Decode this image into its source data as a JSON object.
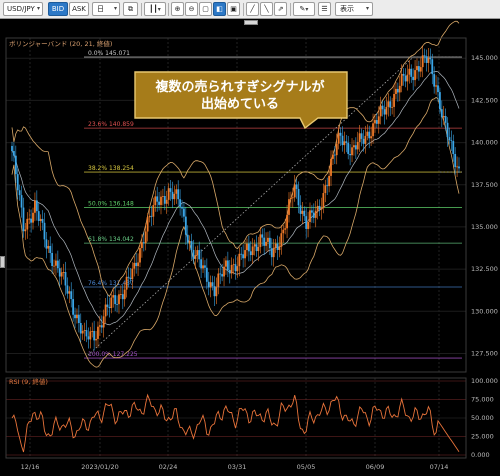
{
  "toolbar": {
    "pair": "USD/JPY",
    "bid": "BID",
    "ask": "ASK",
    "period": "日",
    "display": "表示"
  },
  "main_panel": {
    "indicator_label": "ボリンジャーバンド (20, 21, 終値)",
    "annotation": [
      "複数の売られすぎシグナルが",
      "出始めている"
    ],
    "fib_levels": [
      {
        "label": "0.0%  145.071",
        "value": 145.071,
        "color": "#c9c9c9"
      },
      {
        "label": "23.6%  140.859",
        "value": 140.859,
        "color": "#e05050"
      },
      {
        "label": "38.2%  138.254",
        "value": 138.254,
        "color": "#d8c840"
      },
      {
        "label": "50.0%  136.148",
        "value": 136.148,
        "color": "#5fd06a"
      },
      {
        "label": "61.8%  134.042",
        "value": 134.042,
        "color": "#6ad088"
      },
      {
        "label": "76.4%  131.437",
        "value": 131.437,
        "color": "#4a88d8"
      },
      {
        "label": "100.0%  127.225",
        "value": 127.225,
        "color": "#a855cc"
      }
    ],
    "y_ticks": [
      "145.000",
      "142.500",
      "140.000",
      "137.500",
      "135.000",
      "132.500",
      "130.000",
      "127.500"
    ],
    "y_tick_values": [
      145,
      142.5,
      140,
      137.5,
      135,
      132.5,
      130,
      127.5
    ]
  },
  "rsi_panel": {
    "label": "RSI (9, 終値)",
    "y_ticks": [
      "100.000",
      "75.000",
      "50.000",
      "25.000",
      "0.000"
    ],
    "y_tick_values": [
      100,
      75,
      50,
      25,
      0
    ]
  },
  "x_axis": {
    "labels": [
      "12/16",
      "2023/01/20",
      "02/24",
      "03/31",
      "05/05",
      "06/09",
      "07/14"
    ]
  },
  "colors": {
    "bull": "#f07a28",
    "bear": "#3aa6e8",
    "band": "#d8a868",
    "ma": "#b0b8c0",
    "rsi": "#e8733a",
    "annotation_fill": "#a67c1a"
  }
}
